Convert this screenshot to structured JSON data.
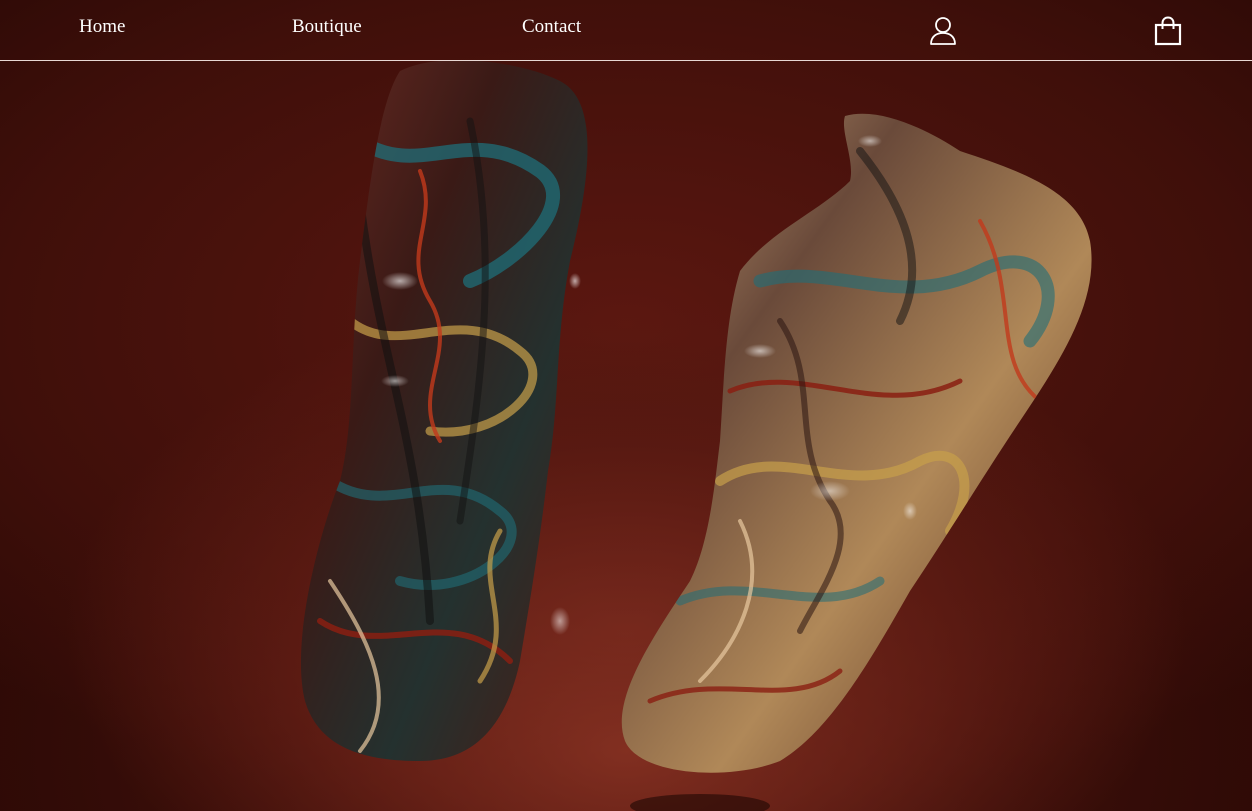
{
  "nav": {
    "links": [
      {
        "label": "Home"
      },
      {
        "label": "Boutique"
      },
      {
        "label": "Contact"
      }
    ],
    "icons": {
      "account": "user-account-icon",
      "cart": "shopping-bag-icon"
    }
  },
  "hero": {
    "image": "floating-sneakers-image",
    "background_color": "#4a120c",
    "accent_colors": [
      "#1f6e78",
      "#c8a04a",
      "#8a1e12",
      "#e8c9a0"
    ]
  }
}
